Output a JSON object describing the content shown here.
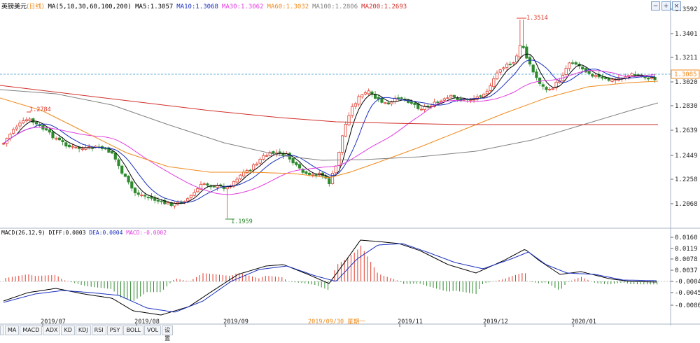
{
  "header": {
    "symbol": "英镑美元",
    "period": "(日线)",
    "ma_set": "MA(5,10,30,60,100,200)",
    "ma_values": [
      {
        "label": "MA5:1.3057",
        "color": "#000000"
      },
      {
        "label": "MA10:1.3068",
        "color": "#1a2fbf"
      },
      {
        "label": "MA30:1.3062",
        "color": "#e23de0"
      },
      {
        "label": "MA60:1.3032",
        "color": "#f08a1c"
      },
      {
        "label": "MA100:1.2806",
        "color": "#808080"
      },
      {
        "label": "MA200:1.2693",
        "color": "#d0302a"
      }
    ]
  },
  "window_controls": {
    "minus": "−",
    "plus": "+",
    "close": "×"
  },
  "price_axis": {
    "ticks": [
      "1.3592",
      "1.3401",
      "1.3211",
      "1.3020",
      "1.2830",
      "1.2639",
      "1.2449",
      "1.2258",
      "1.2068"
    ],
    "current_price": "1.3085"
  },
  "annotations": {
    "high": "1.3514",
    "low": "1.1959",
    "local_high": "1.2784"
  },
  "macd": {
    "label": "MACD(26,12,9)",
    "diff": "DIFF:0.0003",
    "dea": "DEA:0.0004",
    "macd": "MACD:-0.0002",
    "ticks": [
      "0.0160",
      "0.0119",
      "0.0078",
      "0.0037",
      "-0.0004",
      "-0.0045",
      "-0.0086"
    ]
  },
  "time_axis": {
    "months": [
      "2019/07",
      "2019/08",
      "2019/09",
      "2019/11",
      "2019/12",
      "2020/01"
    ],
    "cursor_date": "2019/09/30  星期一"
  },
  "tabs": [
    "MA",
    "MACD",
    "ADX",
    "KD",
    "KDJ",
    "RSI",
    "PSY",
    "BOLL",
    "VOL",
    "设置"
  ],
  "colors": {
    "up": "#e03a2b",
    "down": "#2f8a2f",
    "diff": "#000000",
    "dea": "#1a2fbf",
    "bg": "#ffffff"
  }
}
